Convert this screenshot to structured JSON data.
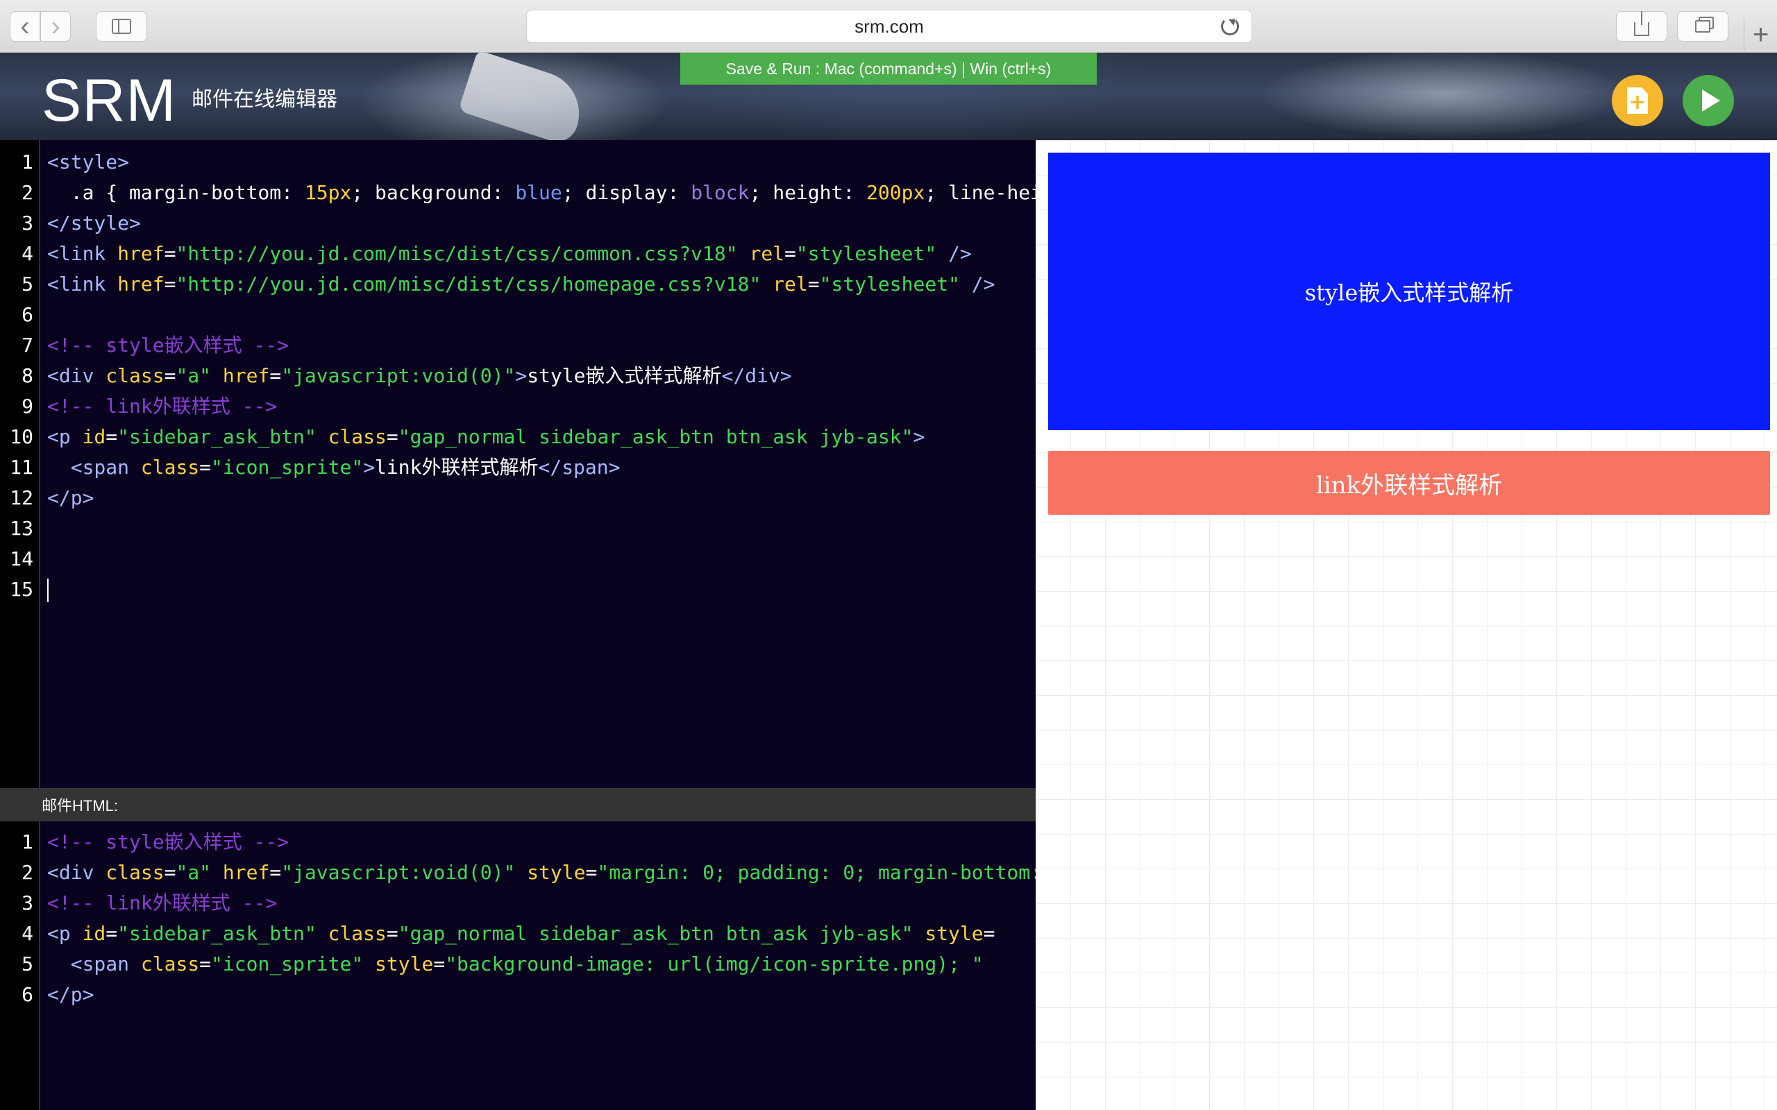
{
  "browser": {
    "url": "srm.com",
    "back_glyph": "‹",
    "forward_glyph": "›",
    "new_tab_glyph": "+"
  },
  "header": {
    "logo": "SRM",
    "subtitle": "邮件在线编辑器",
    "save_run_banner": "Save & Run : Mac (command+s) | Win (ctrl+s)"
  },
  "source_editor": {
    "line_numbers": [
      "1",
      "2",
      "3",
      "4",
      "5",
      "6",
      "7",
      "8",
      "9",
      "10",
      "11",
      "12",
      "13",
      "14",
      "15"
    ]
  },
  "html_panel": {
    "label": "邮件HTML:",
    "line_numbers": [
      "1",
      "2",
      "3",
      "4",
      "5",
      "6"
    ]
  },
  "preview": {
    "block_a_text": "style嵌入式样式解析",
    "block_b_text": "link外联样式解析",
    "block_a_color": "#0a1dff",
    "block_b_color": "#f87462"
  },
  "colors": {
    "editor_bg": "#08021e",
    "accent_green": "#4cae4c",
    "accent_yellow": "#f5b82e"
  }
}
